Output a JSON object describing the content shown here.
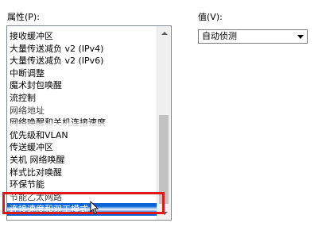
{
  "properties": {
    "label": "属性(P):",
    "items": [
      {
        "label": "接收缓冲区"
      },
      {
        "label": "大量传送减负 v2 (IPv4)"
      },
      {
        "label": "大量传送减负 v2 (IPv6)"
      },
      {
        "label": "中断调整"
      },
      {
        "label": "魔术封包唤醒"
      },
      {
        "label": "流控制"
      },
      {
        "label": "网络地址"
      },
      {
        "label": "网络唤醒和关机连接速度"
      },
      {
        "label": "优先级和VLAN"
      },
      {
        "label": "传送缓冲区"
      },
      {
        "label": "关机 网络唤醒"
      },
      {
        "label": "样式比对唤醒"
      },
      {
        "label": "环保节能"
      },
      {
        "label": "节能乙太网路"
      },
      {
        "label": "连接速度和双工模式"
      }
    ],
    "selected_index": 14
  },
  "value": {
    "label": "值(V):",
    "selected": "自动侦测"
  },
  "icons": {
    "scroll_up": "chevron-up-icon",
    "scroll_down": "chevron-down-icon",
    "dropdown": "dropdown-arrow-icon",
    "cursor": "mouse-pointer-icon"
  },
  "colors": {
    "selection": "#0a64d8",
    "highlight_box": "#e01818"
  }
}
